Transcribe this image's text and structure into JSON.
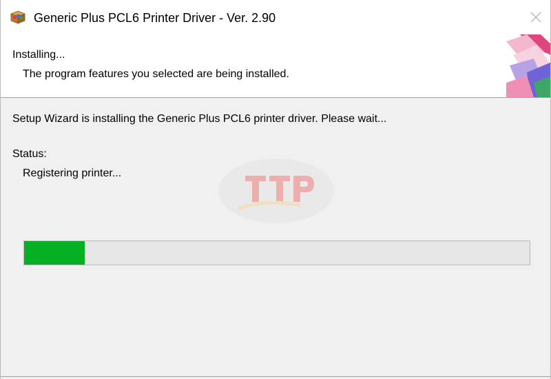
{
  "window": {
    "title": "Generic Plus PCL6 Printer Driver - Ver. 2.90",
    "icon": "installer-box-icon",
    "close_icon": "close-icon"
  },
  "header": {
    "title": "Installing...",
    "subtitle": "The program features you selected are being installed."
  },
  "main": {
    "description": "Setup Wizard is installing the Generic Plus PCL6 printer driver. Please wait...",
    "status_label": "Status:",
    "status_value": "Registering printer...",
    "progress": 0.12
  },
  "colors": {
    "progress_fill": "#06b025",
    "progress_track": "#e6e6e6",
    "window_bg": "#f0f0f0",
    "header_bg": "#ffffff"
  }
}
